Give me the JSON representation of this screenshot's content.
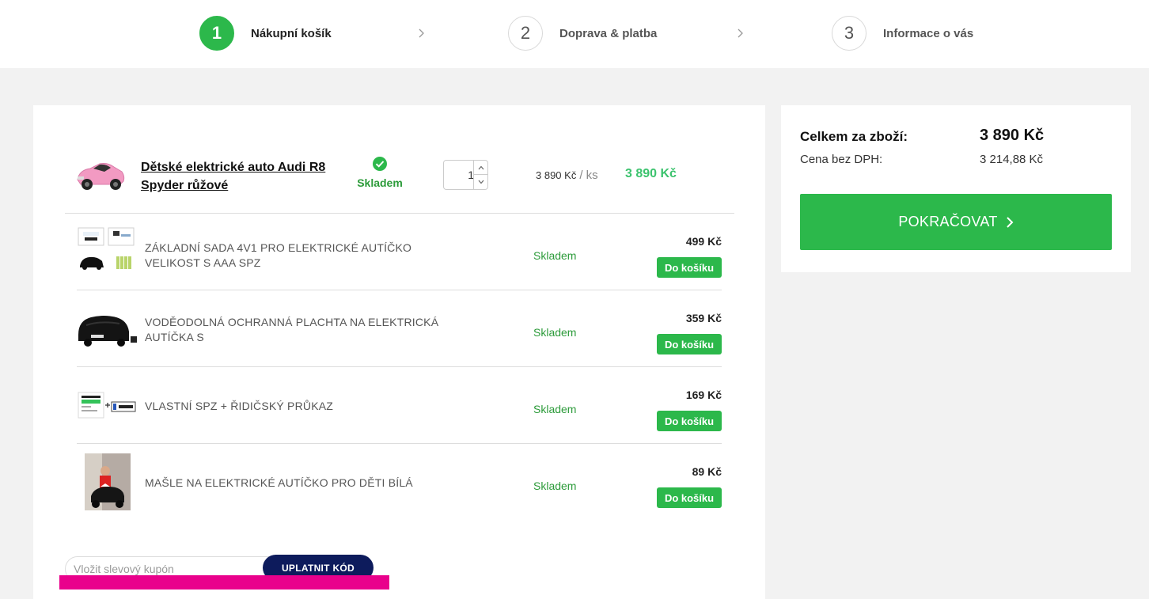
{
  "steps": [
    {
      "num": "1",
      "label": "Nákupní košík",
      "active": true
    },
    {
      "num": "2",
      "label": "Doprava & platba",
      "active": false
    },
    {
      "num": "3",
      "label": "Informace o vás",
      "active": false
    }
  ],
  "cart_item": {
    "name": "Dětské elektrické auto Audi R8 Spyder růžové",
    "stock": "Skladem",
    "quantity": "1",
    "unit_price": "3 890 Kč",
    "unit_suffix": "/ ks",
    "total": "3 890 Kč",
    "thumb_icon": "pink-ride-on-car-image"
  },
  "recommended": [
    {
      "name": "ZÁKLADNÍ SADA 4V1 PRO ELEKTRICKÉ AUTÍČKO VELIKOST S AAA SPZ",
      "stock": "Skladem",
      "price": "499 Kč",
      "button": "Do košíku"
    },
    {
      "name": "VODĚODOLNÁ OCHRANNÁ PLACHTA NA ELEKTRICKÁ AUTÍČKA S",
      "stock": "Skladem",
      "price": "359 Kč",
      "button": "Do košíku"
    },
    {
      "name": "VLASTNÍ SPZ + ŘIDIČSKÝ PRŮKAZ",
      "stock": "Skladem",
      "price": "169 Kč",
      "button": "Do košíku"
    },
    {
      "name": "MAŠLE NA ELEKTRICKÉ AUTÍČKO PRO DĚTI BÍLÁ",
      "stock": "Skladem",
      "price": "89 Kč",
      "button": "Do košíku"
    }
  ],
  "coupon": {
    "placeholder": "Vložit slevový kupón",
    "button": "UPLATNIT KÓD"
  },
  "summary": {
    "total_label": "Celkem za zboží:",
    "total_value": "3 890 Kč",
    "vat_label": "Cena bez DPH:",
    "vat_value": "3 214,88 Kč",
    "continue": "POKRAČOVAT"
  },
  "colors": {
    "accent": "#2cb84b",
    "price_green": "#3cc36e",
    "coupon_button": "#0d1b5c",
    "pink_bar": "#e9018c"
  }
}
